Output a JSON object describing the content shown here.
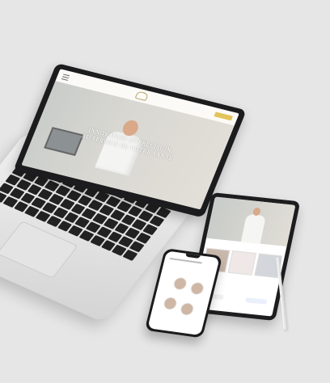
{
  "laptop": {
    "hero_title_line1": "INNOVATION ET PRÉCISION",
    "hero_title_line2": "AU SERVICE DE VOTRE SANTÉ"
  },
  "tablet": {
    "section_caption": ""
  },
  "phone": {
    "heading": ""
  },
  "colors": {
    "background": "#e6e6e6",
    "accent_gold": "#e2c45a",
    "device_dark": "#1c1c1e"
  }
}
